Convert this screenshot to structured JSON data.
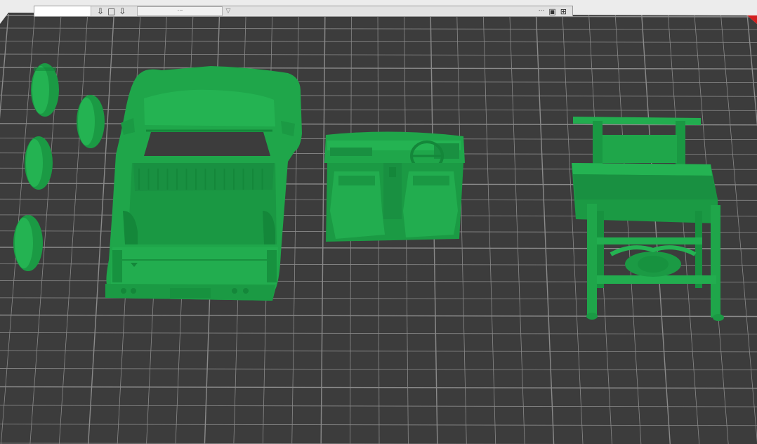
{
  "app": {
    "view": "slicer-build-plate-preview"
  },
  "toolbar": {
    "icons": [
      "arrange-down-icon",
      "square-icon",
      "arrange-down-icon"
    ],
    "field_text": "...",
    "right_text": "...",
    "right_icons": [
      "camera-icon",
      "grid-icon"
    ]
  },
  "scene": {
    "plate_color": "#3c3c3c",
    "grid_color": "#8a8a8a",
    "model_color": "#1fa64a",
    "model_shadow": "#14873a",
    "model_highlight": "#2ec05a",
    "models": [
      "wheel-1",
      "wheel-2",
      "wheel-3",
      "wheel-4",
      "car-body",
      "interior",
      "chassis"
    ]
  }
}
